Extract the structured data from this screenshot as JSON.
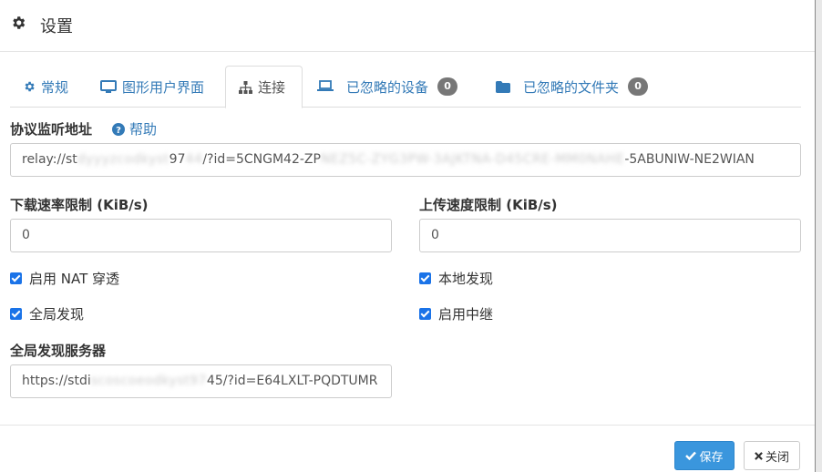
{
  "header": {
    "title": "设置",
    "icon": "gear-icon"
  },
  "tabs": [
    {
      "label": "常规",
      "icon": "gear-icon"
    },
    {
      "label": "图形用户界面",
      "icon": "desktop-icon"
    },
    {
      "label": "连接",
      "icon": "sitemap-icon",
      "active": true
    },
    {
      "label": "已忽略的设备",
      "icon": "laptop-icon",
      "badge": "0"
    },
    {
      "label": "已忽略的文件夹",
      "icon": "folder-icon",
      "badge": "0"
    }
  ],
  "listen": {
    "label": "协议监听地址",
    "help": "帮助",
    "value_start": "relay://st",
    "value_blur1": "dyyyzcodkyst",
    "value_mid": "97",
    "value_blur2": "44",
    "value_mid2": "/?id=5CNGM42-ZP",
    "value_blur3": "NEZ5C-ZYG3PW-3AJKTNA-D45CRE-MM0NAHE",
    "value_end": "-5ABUNIW-NE2WIAN"
  },
  "download": {
    "label": "下载速率限制 (KiB/s)",
    "value": "0"
  },
  "upload": {
    "label": "上传速度限制 (KiB/s)",
    "value": "0"
  },
  "checks": {
    "nat": "启用 NAT 穿透",
    "local": "本地发现",
    "global": "全局发现",
    "relay": "启用中继"
  },
  "discovery": {
    "label": "全局发现服务器",
    "value_start": "https://stdi",
    "value_blur": "scoscoeodkyst97",
    "value_end": "45/?id=E64LXLT-PQDTUMR"
  },
  "footer": {
    "save": "保存",
    "close": "关闭"
  },
  "colors": {
    "link": "#337ab7",
    "primary": "#3a96dd",
    "badge": "#777777",
    "checkbox": "#1a73e8"
  }
}
